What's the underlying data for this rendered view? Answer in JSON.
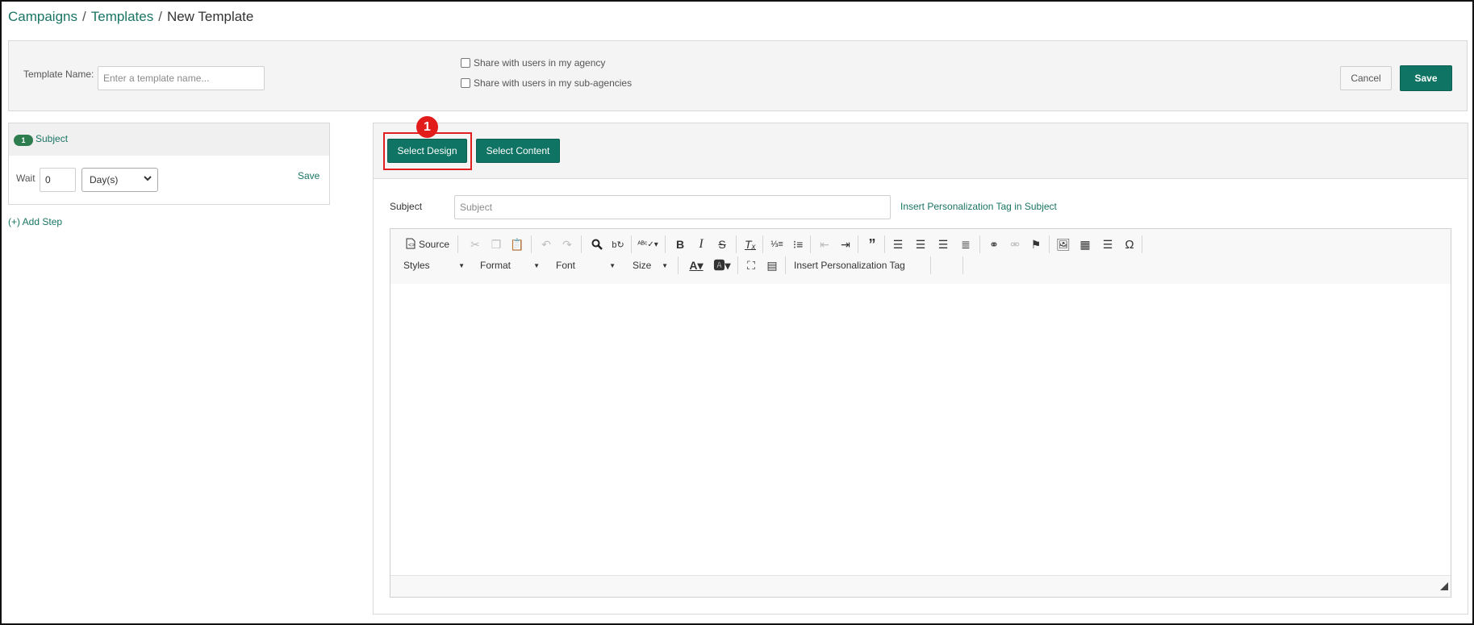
{
  "breadcrumb": {
    "item1": "Campaigns",
    "item2": "Templates",
    "current": "New Template",
    "sep": "/"
  },
  "template_form": {
    "name_label": "Template Name:",
    "name_placeholder": "Enter a template name...",
    "name_value": "",
    "share_agency": "Share with users in my agency",
    "share_subagency": "Share with users in my sub-agencies",
    "cancel": "Cancel",
    "save": "Save"
  },
  "step": {
    "badge": "1",
    "title": "Subject",
    "wait_label": "Wait",
    "wait_value": "0",
    "unit_selected": "Day(s)",
    "save": "Save",
    "add_step": "(+) Add Step"
  },
  "editor": {
    "select_design": "Select Design",
    "select_content": "Select Content",
    "marker": "1",
    "subject_label": "Subject",
    "subject_placeholder": "Subject",
    "insert_tag_subject": "Insert Personalization Tag in Subject",
    "toolbar": {
      "source": "Source",
      "styles": "Styles",
      "format": "Format",
      "font": "Font",
      "size": "Size",
      "insert_tag": "Insert Personalization Tag"
    }
  },
  "colors": {
    "accent": "#0f7463",
    "link": "#1a7464",
    "highlight": "#e02020"
  }
}
